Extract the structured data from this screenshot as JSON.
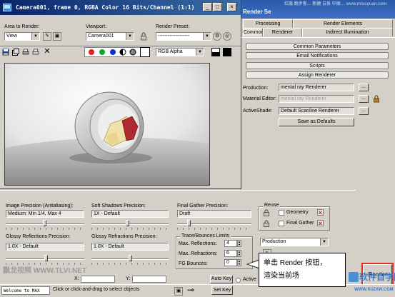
{
  "render_setup": {
    "title": "Render Se",
    "title_deco": "红瓶 跑步客… 新建 日系 中国… www.missyuan.com",
    "tabs_row1": [
      "Processing",
      "Render Elements"
    ],
    "tabs_row2": [
      "Common",
      "Renderer",
      "Indirect Illumination"
    ],
    "rollouts": [
      "Common Parameters",
      "Email Notifications",
      "Scripts",
      "Assign Renderer"
    ],
    "production_label": "Production:",
    "production_value": "mental ray Renderer",
    "material_editor_label": "Material Editor:",
    "material_editor_value": "mental ray Renderer",
    "activeshade_label": "ActiveShade:",
    "activeshade_value": "Default Scanline Renderer",
    "browse_label": "...",
    "save_defaults_label": "Save as Defaults"
  },
  "frame_window": {
    "title": "Camera001, frame 0, RGBA Color 16 Bits/Channel (1:1)",
    "area_label": "Area to Render:",
    "area_value": "View",
    "viewport_label": "Viewport:",
    "viewport_value": "Camera001",
    "preset_label": "Render Preset:",
    "preset_value": "-------------------",
    "channel_value": "RGB Alpha",
    "minimize": "_",
    "maximize": "□",
    "close": "×"
  },
  "bottom_panel": {
    "image_precision_label": "Image Precision (Antialiasing):",
    "image_precision_value": "Medium: Min 1/4, Max 4",
    "soft_shadows_label": "Soft Shadows Precision:",
    "soft_shadows_value": "1X - Default",
    "final_gather_label": "Final Gather Precision:",
    "final_gather_value": "Draft",
    "reuse_label": "Reuse",
    "geometry_label": "Geometry",
    "final_gather_check_label": "Final Gather",
    "glossy_reflections_label": "Glossy Reflections Precision:",
    "glossy_reflections_value": "1.0X - Default",
    "glossy_refractions_label": "Glossy Refractions Precision:",
    "glossy_refractions_value": "1.0X - Default",
    "trace_group_label": "Trace/Bounces Limits",
    "max_reflections_label": "Max. Reflections:",
    "max_reflections_value": "4",
    "max_refractions_label": "Max. Refractions:",
    "max_refractions_value": "6",
    "fg_bounces_label": "FG Bounces:",
    "fg_bounces_value": "0",
    "production_mode": "Production",
    "render_button": "Render"
  },
  "status_bar": {
    "maxscript": "Welcome to MAX",
    "prompt": "Click or click-and-drag to select objects",
    "x_label": "X:",
    "y_label": "Y:",
    "auto_key": "Auto Key",
    "set_key": "Set Key",
    "active_label": "Active"
  },
  "callout": {
    "line1": "单击 Render 按钮，",
    "line2": "渲染当前场"
  },
  "watermarks": {
    "left": "飘龙视频 WWW.TLVI.NET",
    "right": "软件自学网",
    "right_url": "WWW.RJZXW.COM"
  },
  "colors": {
    "title_active": "#0a246a",
    "face": "#d4d0c8",
    "highlight": "#e03020"
  }
}
